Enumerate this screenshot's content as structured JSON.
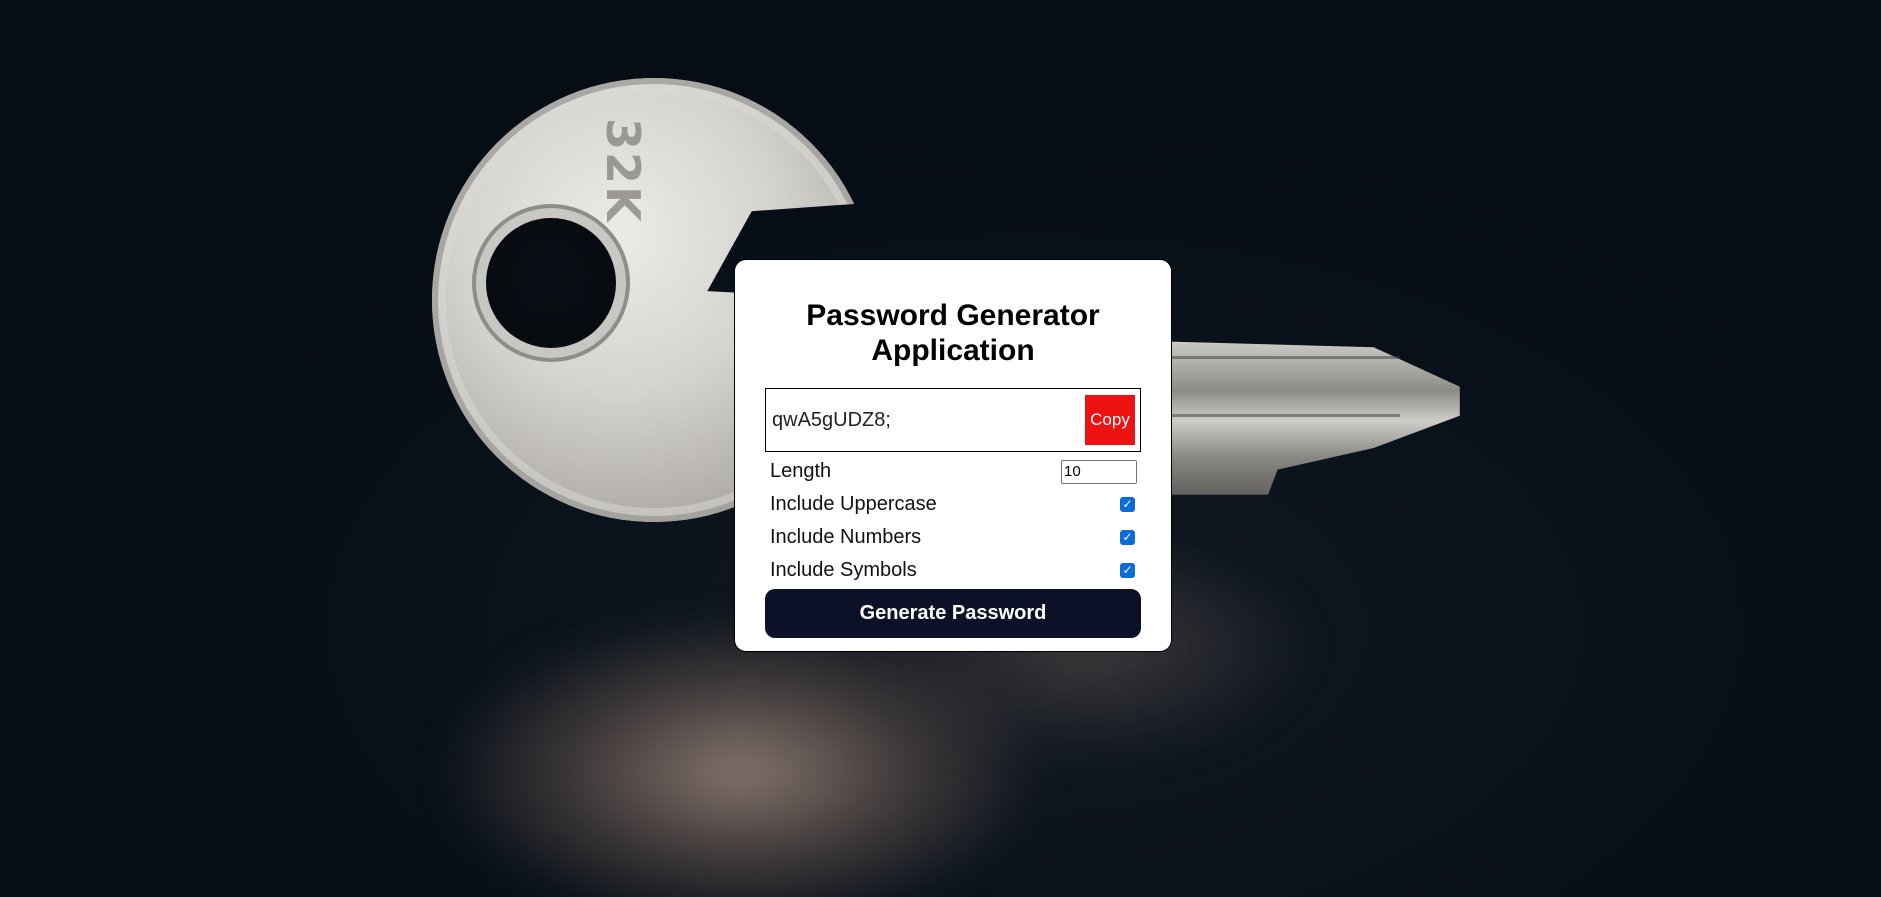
{
  "app": {
    "title": "Password Generator Application"
  },
  "result": {
    "password": "qwA5gUDZ8;",
    "copy_label": "Copy"
  },
  "settings": {
    "length_label": "Length",
    "length_value": "10",
    "options": [
      {
        "label": "Include Uppercase",
        "checked": true
      },
      {
        "label": "Include Numbers",
        "checked": true
      },
      {
        "label": "Include Symbols",
        "checked": true
      }
    ]
  },
  "generate_label": "Generate Password",
  "background": {
    "key_marking": "32K"
  },
  "colors": {
    "copy_button": "#ee1111",
    "generate_button": "#0c1128",
    "checkbox": "#0b6bd8"
  },
  "icons": {
    "checkbox_checked": "checkmark-icon"
  }
}
